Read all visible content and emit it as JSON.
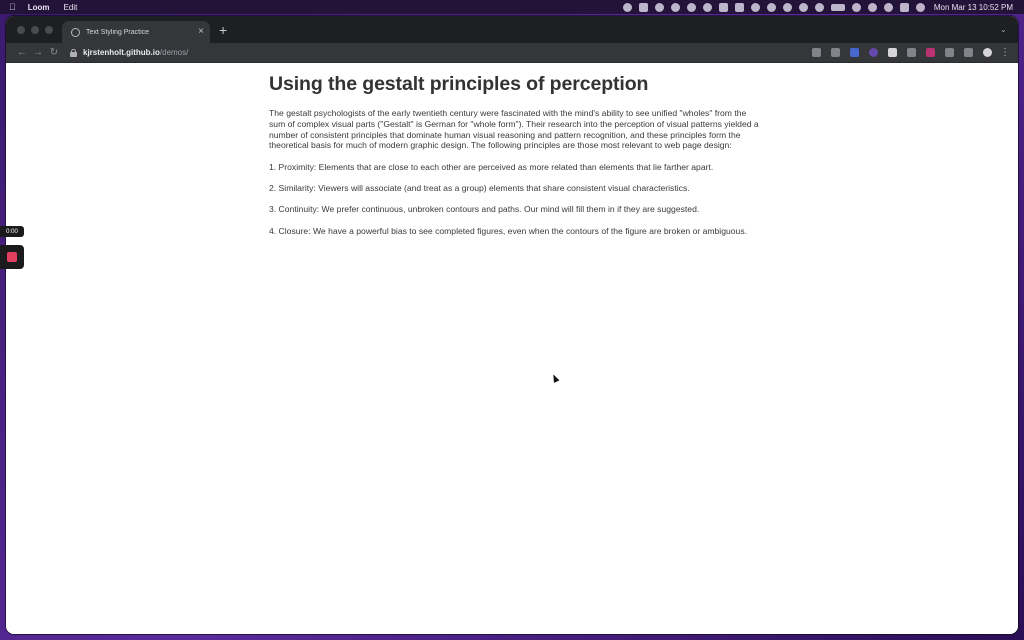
{
  "menubar": {
    "apple_icon": "apple-icon",
    "app_name": "Loom",
    "menu_edit": "Edit",
    "clock": "Mon Mar 13  10:52 PM"
  },
  "browser": {
    "tab_title": "Text Styling Practice",
    "tab_close": "×",
    "new_tab": "+",
    "url_host": "kjrstenholt.github.io",
    "url_path": "/demos/",
    "back": "←",
    "forward": "→",
    "reload": "↻",
    "more": "⋮"
  },
  "article": {
    "title": "Using the gestalt principles of perception",
    "intro": "The gestalt psychologists of the early twentieth century were fascinated with the mind's ability to see unified \"wholes\" from the sum of complex visual parts (\"Gestalt\" is German for \"whole form\"). Their research into the perception of visual patterns yielded a number of consistent principles that dominate human visual reasoning and pattern recognition, and these principles form the theoretical basis for much of modern graphic design. The following principles are those most relevant to web page design:",
    "principles": [
      "1. Proximity: Elements that are close to each other are perceived as more related than elements that lie farther apart.",
      "2. Similarity: Viewers will associate (and treat as a group) elements that share consistent visual characteristics.",
      "3. Continuity: We prefer continuous, unbroken contours and paths. Our mind will fill them in if they are suggested.",
      "4. Closure: We have a powerful bias to see completed figures, even when the contours of the figure are broken or ambiguous."
    ]
  },
  "loom": {
    "timer": "0:00"
  }
}
